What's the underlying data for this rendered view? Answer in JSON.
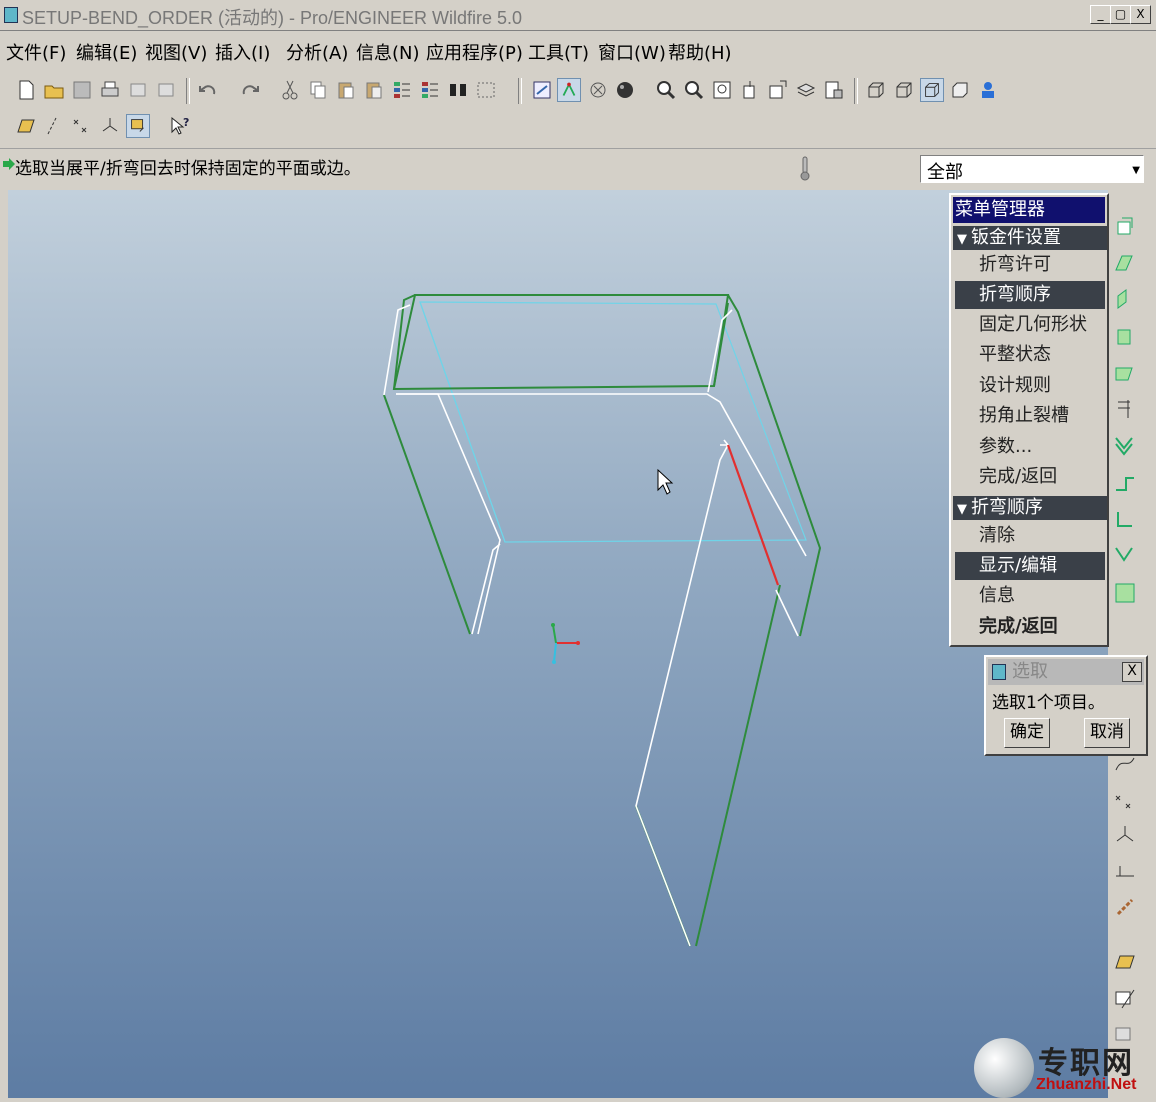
{
  "window": {
    "title": "SETUP-BEND_ORDER (活动的) - Pro/ENGINEER Wildfire 5.0",
    "minimize": "_",
    "maximize": "▢",
    "close": "X"
  },
  "menubar": [
    {
      "label": "文件(F)"
    },
    {
      "label": "编辑(E)"
    },
    {
      "label": "视图(V)"
    },
    {
      "label": "插入(I)"
    },
    {
      "label": "分析(A)"
    },
    {
      "label": "信息(N)"
    },
    {
      "label": "应用程序(P)"
    },
    {
      "label": "工具(T)"
    },
    {
      "label": "窗口(W)"
    },
    {
      "label": "帮助(H)"
    }
  ],
  "toolbar_icons": [
    "new-file-icon",
    "open-folder-icon",
    "save-icon",
    "print-icon",
    "send-mail-icon",
    "mail-icon",
    "undo-icon",
    "redo-icon",
    "cut-icon",
    "copy-icon",
    "paste-icon",
    "paste-special-icon",
    "regenerate-icon",
    "regen-manager-icon",
    "find-icon",
    "selection-box-icon",
    "repaint-icon",
    "spin-center-icon",
    "orient-icon",
    "appearance-icon",
    "zoom-in-icon",
    "zoom-out-icon",
    "refit-icon",
    "reorient-icon",
    "saved-views-icon",
    "layers-icon",
    "view-manager-icon",
    "wireframe-icon",
    "hidden-line-icon",
    "no-hidden-icon",
    "shading-icon",
    "model-tree-icon"
  ],
  "datum_icons": [
    "datum-planes-icon",
    "datum-axes-icon",
    "datum-points-icon",
    "csys-icon",
    "annotations-icon",
    "context-help-icon"
  ],
  "status": {
    "message": "选取当展平/折弯回去时保持固定的平面或边。",
    "filter_value": "全部"
  },
  "menu_manager": {
    "title": "菜单管理器",
    "sections": [
      {
        "header": "钣金件设置",
        "items": [
          {
            "label": "折弯许可",
            "selected": false
          },
          {
            "label": "折弯顺序",
            "selected": true
          },
          {
            "label": "固定几何形状",
            "selected": false
          },
          {
            "label": "平整状态",
            "selected": false
          },
          {
            "label": "设计规则",
            "selected": false
          },
          {
            "label": "拐角止裂槽",
            "selected": false
          },
          {
            "label": "参数...",
            "selected": false
          },
          {
            "label": "完成/返回",
            "selected": false
          }
        ]
      },
      {
        "header": "折弯顺序",
        "items": [
          {
            "label": "清除",
            "selected": false
          },
          {
            "label": "显示/编辑",
            "selected": true
          },
          {
            "label": "信息",
            "selected": false
          },
          {
            "label": "完成/返回",
            "selected": false
          }
        ]
      }
    ]
  },
  "select_dialog": {
    "title": "选取",
    "close": "X",
    "message": "选取1个项目。",
    "ok_label": "确定",
    "cancel_label": "取消"
  },
  "watermark": {
    "cn": "专职网",
    "en": "Zhuanzhi.Net"
  },
  "colors": {
    "model_edge": "#2e8b3c",
    "silhouette": "#ffffff",
    "hidden_edge": "#6fd4e8",
    "highlight_edge": "#e23030",
    "menu_title_bg": "#10106e",
    "menu_selected_bg": "#3a4048"
  }
}
